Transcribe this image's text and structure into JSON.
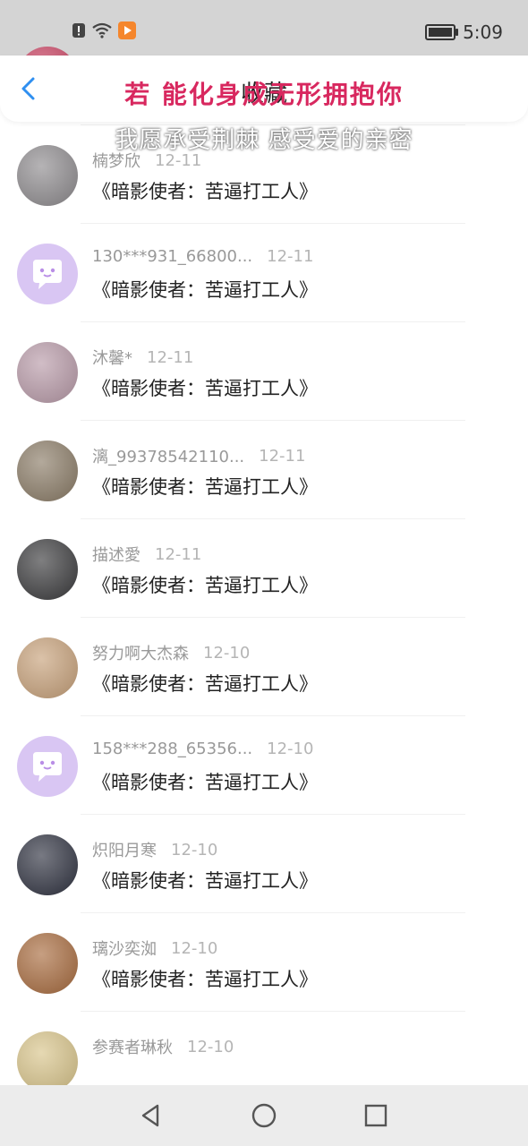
{
  "status": {
    "time": "5:09",
    "icons": [
      "alert-icon",
      "wifi-icon",
      "app-notification-icon"
    ],
    "battery_icon": "battery-icon"
  },
  "header": {
    "back_icon": "chevron-left-icon",
    "title": "收藏",
    "lyric_overlay": "若 能化身成无形拥抱你",
    "lyric_overlay_2": "我愿承受荆棘 感受爱的亲密"
  },
  "items": [
    {
      "name": "",
      "time": "",
      "content": "《暗影使者：苦逼打工人》",
      "avatar_color": "#c94060"
    },
    {
      "name": "楠梦欣",
      "time": "12-11",
      "content": "《暗影使者：苦逼打工人》",
      "avatar_color": "#8e8b8e"
    },
    {
      "name": "130***931_66800...",
      "time": "12-11",
      "content": "《暗影使者：苦逼打工人》",
      "avatar_color": "#d9c6f3",
      "default_avatar": true
    },
    {
      "name": "沐馨*",
      "time": "12-11",
      "content": "《暗影使者：苦逼打工人》",
      "avatar_color": "#b89aa8"
    },
    {
      "name": "漓_99378542110...",
      "time": "12-11",
      "content": "《暗影使者：苦逼打工人》",
      "avatar_color": "#8a7b66"
    },
    {
      "name": "描述愛",
      "time": "12-11",
      "content": "《暗影使者：苦逼打工人》",
      "avatar_color": "#3a3a3c"
    },
    {
      "name": "努力啊大杰森",
      "time": "12-10",
      "content": "《暗影使者：苦逼打工人》",
      "avatar_color": "#c7a17a"
    },
    {
      "name": "158***288_65356...",
      "time": "12-10",
      "content": "《暗影使者：苦逼打工人》",
      "avatar_color": "#d9c6f3",
      "default_avatar": true
    },
    {
      "name": "炽阳月寒",
      "time": "12-10",
      "content": "《暗影使者：苦逼打工人》",
      "avatar_color": "#2f3240"
    },
    {
      "name": "璃沙奕洳",
      "time": "12-10",
      "content": "《暗影使者：苦逼打工人》",
      "avatar_color": "#a86b3e"
    },
    {
      "name": "参赛者琳秋",
      "time": "12-10",
      "content": "",
      "avatar_color": "#d8c48a"
    }
  ],
  "navbar": {
    "back_icon": "triangle-back-icon",
    "home_icon": "circle-home-icon",
    "recent_icon": "square-recent-icon"
  },
  "colors": {
    "accent_blue": "#2f8ff0",
    "lyric_red": "#d8285f",
    "name_gray": "#999999",
    "default_avatar_purple": "#d9c6f3"
  }
}
